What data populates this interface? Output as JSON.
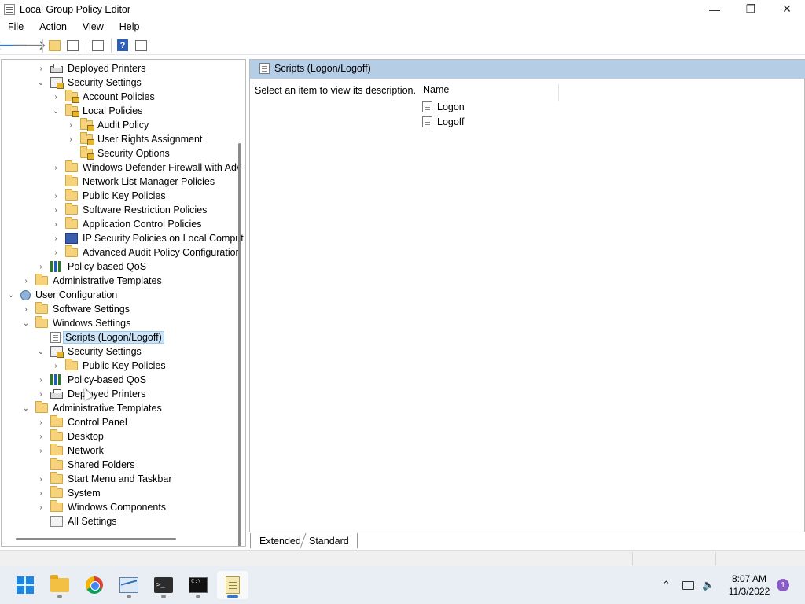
{
  "window": {
    "title": "Local Group Policy Editor",
    "minimize": "—",
    "maximize": "❐",
    "close": "✕"
  },
  "menu": [
    "File",
    "Action",
    "View",
    "Help"
  ],
  "toolbar": {
    "back": "🡐",
    "forward": "🡒",
    "help": "?"
  },
  "tree": [
    {
      "label": "Deployed Printers",
      "icon": "printer-icon",
      "expander": "›"
    },
    {
      "label": "Security Settings",
      "icon": "security-settings-icon",
      "expander": "⌄"
    },
    {
      "label": "Account Policies",
      "icon": "locked-folder-icon",
      "expander": "›"
    },
    {
      "label": "Local Policies",
      "icon": "locked-folder-icon",
      "expander": "⌄"
    },
    {
      "label": "Audit Policy",
      "icon": "locked-folder-icon",
      "expander": "›"
    },
    {
      "label": "User Rights Assignment",
      "icon": "locked-folder-icon",
      "expander": "›"
    },
    {
      "label": "Security Options",
      "icon": "locked-folder-icon",
      "expander": ""
    },
    {
      "label": "Windows Defender Firewall with Adv",
      "icon": "folder-icon",
      "expander": "›"
    },
    {
      "label": "Network List Manager Policies",
      "icon": "folder-icon",
      "expander": ""
    },
    {
      "label": "Public Key Policies",
      "icon": "folder-icon",
      "expander": "›"
    },
    {
      "label": "Software Restriction Policies",
      "icon": "folder-icon",
      "expander": "›"
    },
    {
      "label": "Application Control Policies",
      "icon": "folder-icon",
      "expander": "›"
    },
    {
      "label": "IP Security Policies on Local Comput",
      "icon": "ipsec-icon",
      "expander": "›"
    },
    {
      "label": "Advanced Audit Policy Configuratior",
      "icon": "folder-icon",
      "expander": "›"
    },
    {
      "label": "Policy-based QoS",
      "icon": "qos-icon",
      "expander": "›"
    },
    {
      "label": "Administrative Templates",
      "icon": "folder-icon",
      "expander": "›"
    },
    {
      "label": "User Configuration",
      "icon": "user-config-icon",
      "expander": "⌄"
    },
    {
      "label": "Software Settings",
      "icon": "folder-icon",
      "expander": "›"
    },
    {
      "label": "Windows Settings",
      "icon": "folder-icon",
      "expander": "⌄"
    },
    {
      "label": "Scripts (Logon/Logoff)",
      "icon": "script-icon",
      "expander": ""
    },
    {
      "label": "Security Settings",
      "icon": "security-settings-icon",
      "expander": "⌄"
    },
    {
      "label": "Public Key Policies",
      "icon": "folder-icon",
      "expander": "›"
    },
    {
      "label": "Policy-based QoS",
      "icon": "qos-icon",
      "expander": "›"
    },
    {
      "label": "Deployed Printers",
      "icon": "printer-icon",
      "expander": "›"
    },
    {
      "label": "Administrative Templates",
      "icon": "folder-icon",
      "expander": "⌄"
    },
    {
      "label": "Control Panel",
      "icon": "folder-icon",
      "expander": "›"
    },
    {
      "label": "Desktop",
      "icon": "folder-icon",
      "expander": "›"
    },
    {
      "label": "Network",
      "icon": "folder-icon",
      "expander": "›"
    },
    {
      "label": "Shared Folders",
      "icon": "folder-icon",
      "expander": ""
    },
    {
      "label": "Start Menu and Taskbar",
      "icon": "folder-icon",
      "expander": "›"
    },
    {
      "label": "System",
      "icon": "folder-icon",
      "expander": "›"
    },
    {
      "label": "Windows Components",
      "icon": "folder-icon",
      "expander": "›"
    },
    {
      "label": "All Settings",
      "icon": "settings-icon",
      "expander": ""
    }
  ],
  "right": {
    "header": "Scripts (Logon/Logoff)",
    "description": "Select an item to view its description.",
    "column_name": "Name",
    "items": [
      "Logon",
      "Logoff"
    ]
  },
  "tabs": [
    "Extended",
    "Standard"
  ],
  "taskbar": {
    "time": "8:07 AM",
    "date": "11/3/2022",
    "notifications": "1"
  }
}
